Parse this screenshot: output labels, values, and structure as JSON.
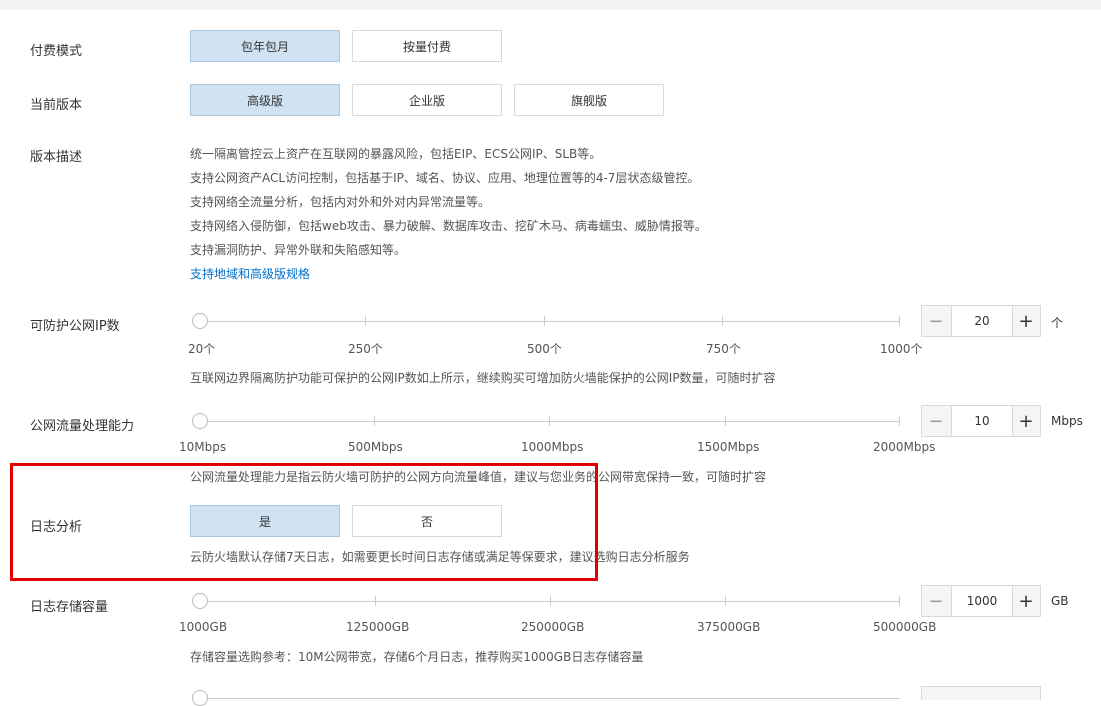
{
  "billing": {
    "label": "付费模式",
    "options": [
      "包年包月",
      "按量付费"
    ],
    "selected": 0
  },
  "edition": {
    "label": "当前版本",
    "options": [
      "高级版",
      "企业版",
      "旗舰版"
    ],
    "selected": 0
  },
  "description": {
    "label": "版本描述",
    "lines": [
      "统一隔离管控云上资产在互联网的暴露风险，包括EIP、ECS公网IP、SLB等。",
      "支持公网资产ACL访问控制，包括基于IP、域名、协议、应用、地理位置等的4-7层状态级管控。",
      "支持网络全流量分析，包括内对外和外对内异常流量等。",
      "支持网络入侵防御，包括web攻击、暴力破解、数据库攻击、挖矿木马、病毒蠕虫、威胁情报等。",
      "支持漏洞防护、异常外联和失陷感知等。"
    ],
    "link": "支持地域和高级版规格"
  },
  "ip_count": {
    "label": "可防护公网IP数",
    "ticks": [
      "20个",
      "250个",
      "500个",
      "750个",
      "1000个"
    ],
    "value": "20",
    "unit": "个",
    "hint": "互联网边界隔离防护功能可保护的公网IP数如上所示，继续购买可增加防火墙能保护的公网IP数量，可随时扩容"
  },
  "bandwidth": {
    "label": "公网流量处理能力",
    "ticks": [
      "10Mbps",
      "500Mbps",
      "1000Mbps",
      "1500Mbps",
      "2000Mbps"
    ],
    "value": "10",
    "unit": "Mbps",
    "hint": "公网流量处理能力是指云防火墙可防护的公网方向流量峰值，建议与您业务的公网带宽保持一致，可随时扩容"
  },
  "log_analysis": {
    "label": "日志分析",
    "options": [
      "是",
      "否"
    ],
    "selected": 0,
    "hint": "云防火墙默认存储7天日志，如需要更长时间日志存储或满足等保要求，建议选购日志分析服务"
  },
  "log_storage": {
    "label": "日志存储容量",
    "ticks": [
      "1000GB",
      "125000GB",
      "250000GB",
      "375000GB",
      "500000GB"
    ],
    "value": "1000",
    "unit": "GB",
    "hint": "存储容量选购参考：10M公网带宽，存储6个月日志，推荐购买1000GB日志存储容量"
  },
  "stepper_icons": {
    "minus": "minus-icon",
    "plus": "plus-icon"
  },
  "colors": {
    "active_bg": "#d0e3f2",
    "highlight": "#e00000",
    "link": "#0070cc"
  }
}
